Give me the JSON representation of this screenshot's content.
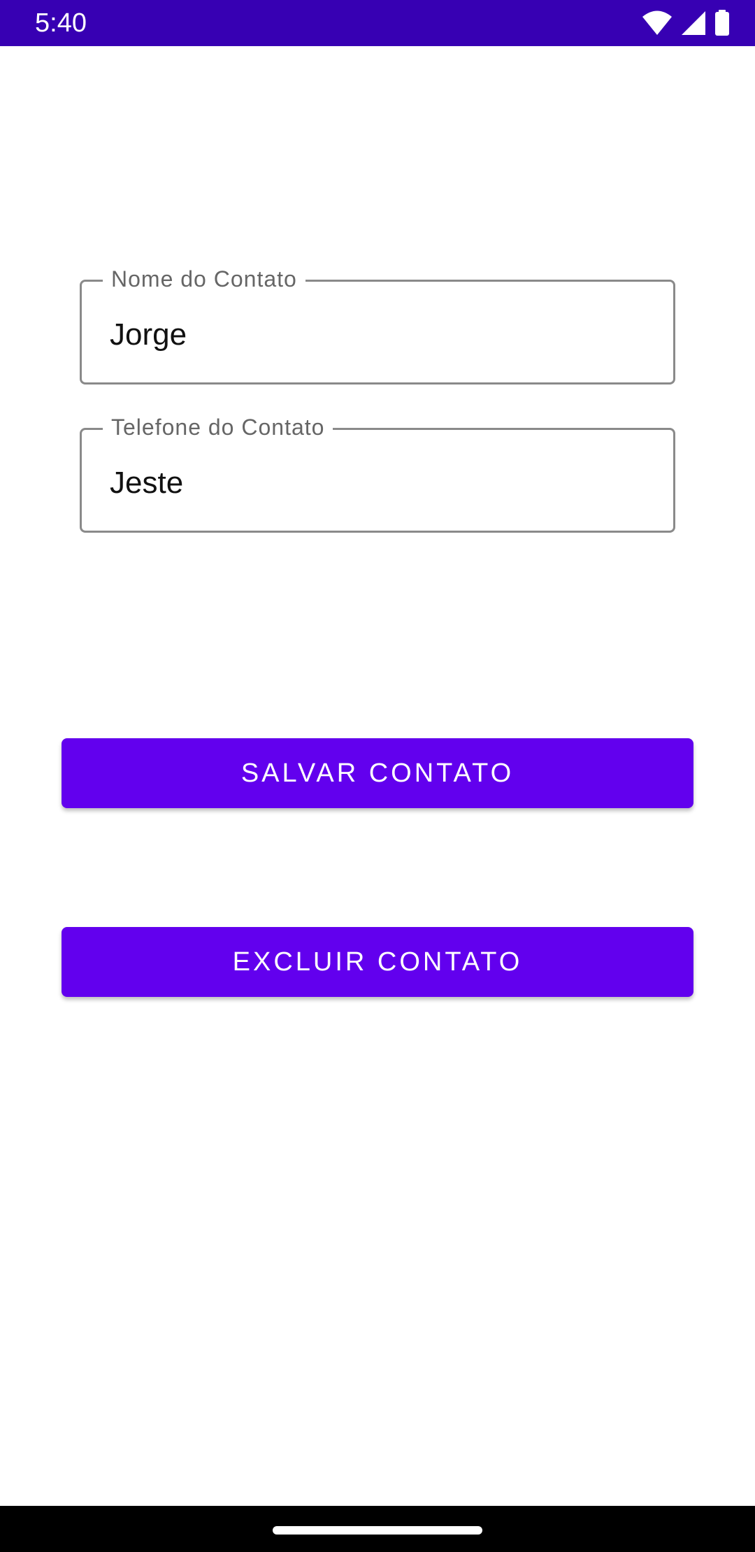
{
  "status_bar": {
    "time": "5:40",
    "icons": [
      "wifi-icon",
      "cell-signal-icon",
      "battery-icon"
    ],
    "background_color": "#3700b3"
  },
  "form": {
    "name_field": {
      "label": "Nome do Contato",
      "value": "Jorge"
    },
    "phone_field": {
      "label": "Telefone do Contato",
      "value": "Jeste"
    }
  },
  "actions": {
    "save_label": "SALVAR CONTATO",
    "delete_label": "EXCLUIR CONTATO",
    "button_color": "#6200ee"
  },
  "navigation": {
    "home_indicator": "home-indicator"
  }
}
